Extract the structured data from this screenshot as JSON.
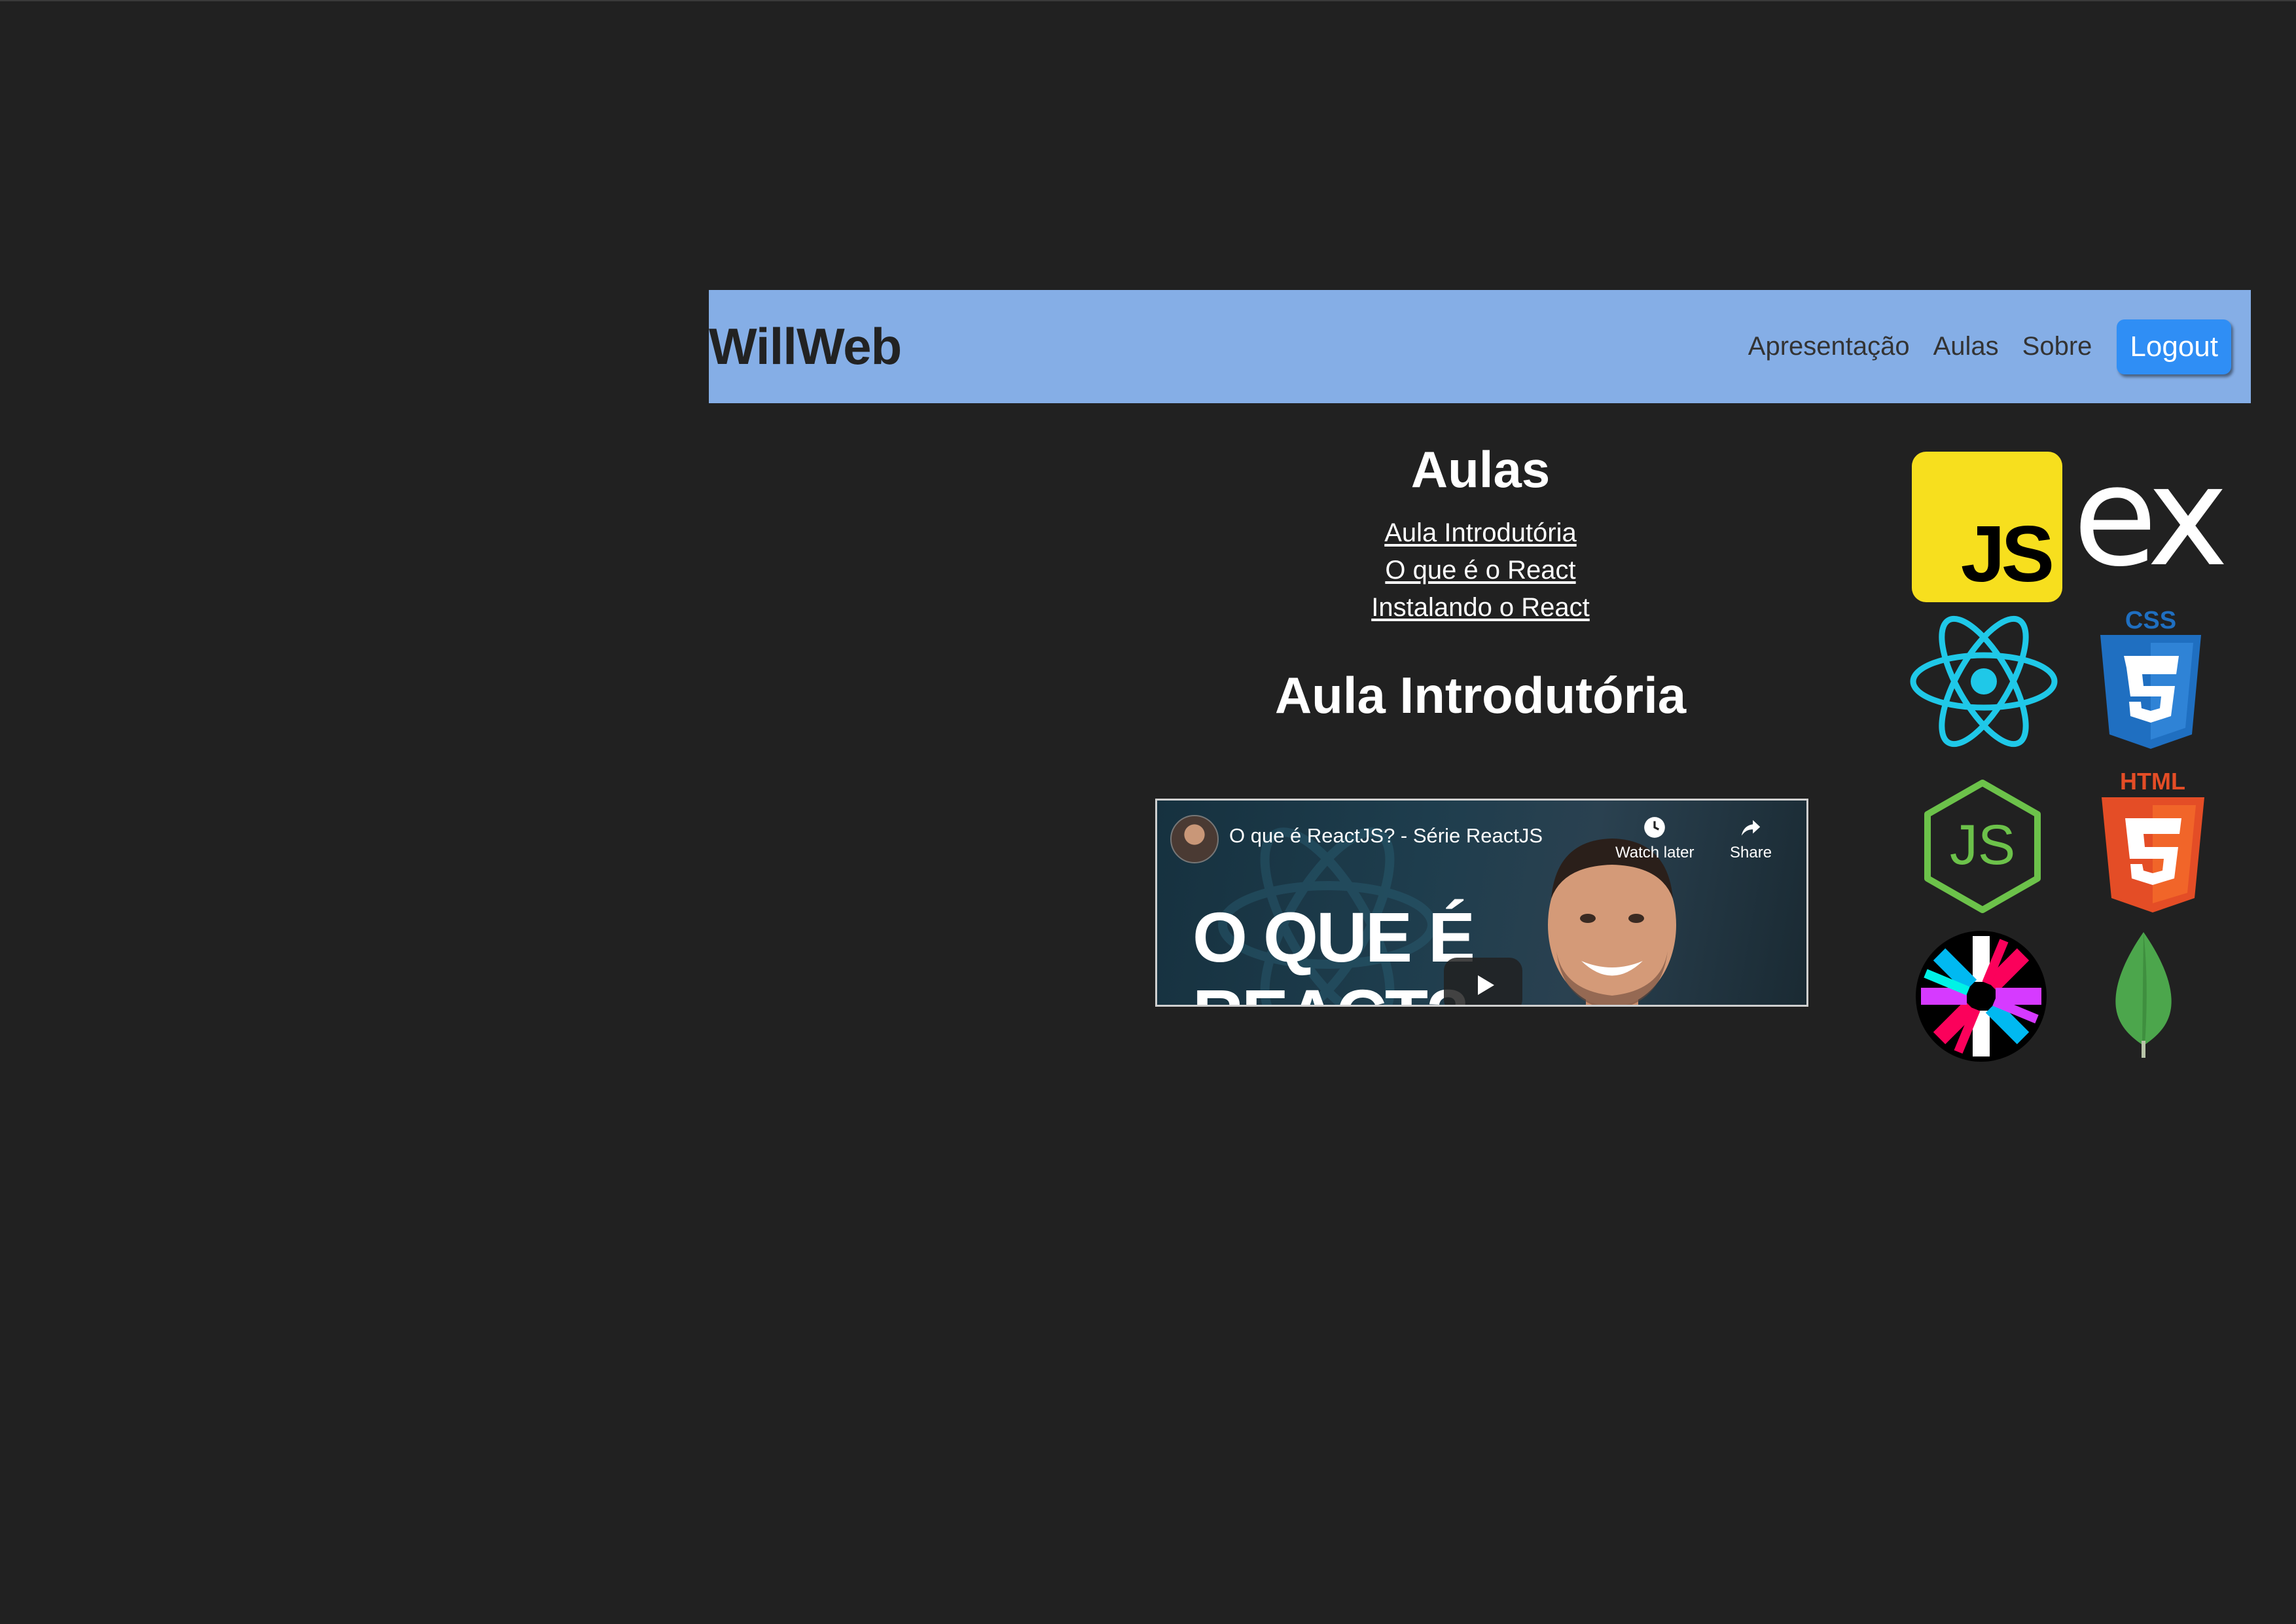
{
  "navbar": {
    "brand": "WillWeb",
    "links": [
      "Apresentação",
      "Aulas",
      "Sobre"
    ],
    "logout_label": "Logout",
    "background": "#85aee6",
    "button_color": "#2f8ef5"
  },
  "main": {
    "section_title": "Aulas",
    "lessons": [
      "Aula Introdutória",
      "O que é o React",
      "Instalando o React"
    ],
    "current_lesson_title": "Aula Introdutória"
  },
  "video": {
    "title": "O que é ReactJS? - Série ReactJS",
    "watch_later": "Watch later",
    "share": "Share",
    "thumbnail_text_line1": "O QUE É",
    "thumbnail_text_line2": "REACT?"
  },
  "logos": {
    "js": "JS",
    "express": "ex",
    "css": "CSS",
    "html": "HTML",
    "items": [
      "javascript-logo",
      "express-logo",
      "react-logo",
      "css3-logo",
      "nodejs-logo",
      "html5-logo",
      "jwt-logo",
      "mongodb-logo"
    ]
  },
  "colors": {
    "page_background": "#212121",
    "react": "#1fc8e8",
    "css": "#1f6fc1",
    "html": "#e44d26",
    "node": "#6cc24a",
    "mongodb": "#4ca64c"
  }
}
